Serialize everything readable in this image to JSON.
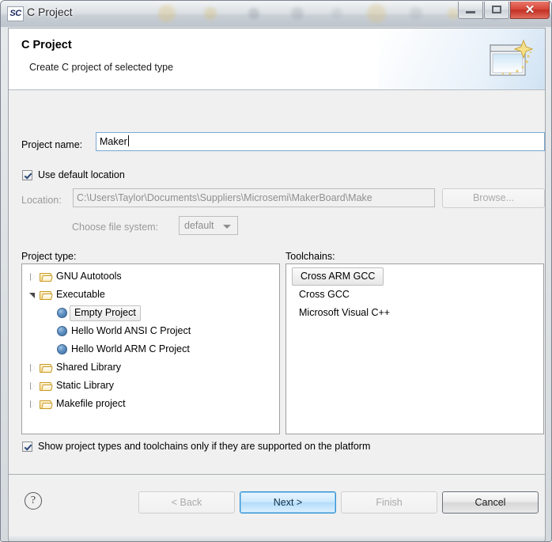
{
  "window": {
    "logo_text": "SC",
    "title": "C Project",
    "minimize_label": "Minimize",
    "maximize_label": "Maximize",
    "close_label": "✕"
  },
  "header": {
    "title": "C Project",
    "subtitle": "Create C project of selected type",
    "icon_name": "new-project-wizard-icon"
  },
  "form": {
    "project_name_label": "Project name:",
    "project_name_value": "Maker",
    "use_default_location_label": "Use default location",
    "use_default_location_checked": true,
    "location_label": "Location:",
    "location_value": "C:\\Users\\Taylor\\Documents\\Suppliers\\Microsemi\\MakerBoard\\Make",
    "browse_label": "Browse...",
    "file_system_label": "Choose file system:",
    "file_system_value": "default",
    "file_system_options": [
      "default"
    ]
  },
  "project_type": {
    "label": "Project type:",
    "items": [
      {
        "label": "GNU Autotools",
        "kind": "folder",
        "state": "collapsed",
        "indent": 0,
        "selected": false
      },
      {
        "label": "Executable",
        "kind": "folder",
        "state": "expanded",
        "indent": 0,
        "selected": false
      },
      {
        "label": "Empty Project",
        "kind": "leaf",
        "state": "none",
        "indent": 1,
        "selected": true
      },
      {
        "label": "Hello World ANSI C Project",
        "kind": "leaf",
        "state": "none",
        "indent": 1,
        "selected": false
      },
      {
        "label": "Hello World ARM C Project",
        "kind": "leaf",
        "state": "none",
        "indent": 1,
        "selected": false
      },
      {
        "label": "Shared Library",
        "kind": "folder",
        "state": "collapsed",
        "indent": 0,
        "selected": false
      },
      {
        "label": "Static Library",
        "kind": "folder",
        "state": "collapsed",
        "indent": 0,
        "selected": false
      },
      {
        "label": "Makefile project",
        "kind": "folder",
        "state": "collapsed",
        "indent": 0,
        "selected": false
      }
    ]
  },
  "toolchains": {
    "label": "Toolchains:",
    "items": [
      {
        "label": "Cross ARM GCC",
        "selected": true
      },
      {
        "label": "Cross GCC",
        "selected": false
      },
      {
        "label": "Microsoft Visual C++",
        "selected": false
      }
    ]
  },
  "options": {
    "show_supported_label": "Show project types and toolchains only if they are supported on the platform",
    "show_supported_checked": true
  },
  "footer": {
    "help_glyph": "?",
    "back_label": "< Back",
    "next_label": "Next >",
    "finish_label": "Finish",
    "cancel_label": "Cancel"
  },
  "colors": {
    "accent_blue": "#2e8fd4",
    "close_red": "#d7483a",
    "folder_gold": "#c89a28",
    "dialog_bg": "#f0f0f0"
  }
}
